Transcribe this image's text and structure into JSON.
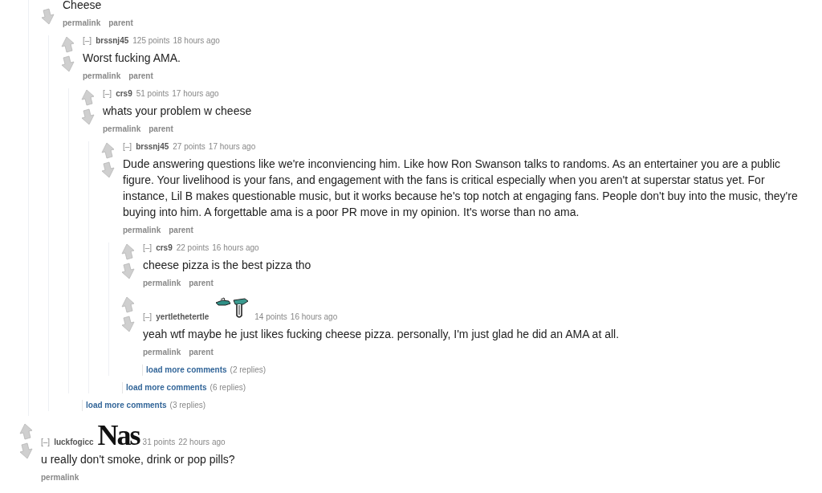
{
  "thread": {
    "comments": [
      {
        "body": "Cheese",
        "buttons": [
          "permalink",
          "parent"
        ],
        "children": [
          {
            "collapse": "[–]",
            "author": "brssnj45",
            "score": "125 points",
            "time": "18 hours ago",
            "body": "Worst fucking AMA.",
            "buttons": [
              "permalink",
              "parent"
            ],
            "children": [
              {
                "collapse": "[–]",
                "author": "crs9",
                "score": "51 points",
                "time": "17 hours ago",
                "body": "whats your problem w cheese",
                "buttons": [
                  "permalink",
                  "parent"
                ],
                "children": [
                  {
                    "collapse": "[–]",
                    "author": "brssnj45",
                    "score": "27 points",
                    "time": "17 hours ago",
                    "body": "Dude answering questions like we're inconviencing him. Like how Ron Swanson talks to randoms. As an entertainer you are a public figure. Your livelihood is your fans, and engagement with the fans is critical especially when you aren't at superstar status yet. For instance, Lil B makes questionable music, but it works because he's top notch at engaging fans. People don't buy into the music, they're buying into him. A forgettable ama is a poor PR move in my opinion. It's worse than no ama.",
                    "buttons": [
                      "permalink",
                      "parent"
                    ],
                    "children": [
                      {
                        "collapse": "[–]",
                        "author": "crs9",
                        "score": "22 points",
                        "time": "16 hours ago",
                        "body": "cheese pizza is the best pizza tho",
                        "buttons": [
                          "permalink",
                          "parent"
                        ]
                      },
                      {
                        "collapse": "[–]",
                        "author": "yertlethetertle",
                        "flair": {
                          "kind": "hands"
                        },
                        "score": "14 points",
                        "time": "16 hours ago",
                        "body": "yeah wtf maybe he just likes fucking cheese pizza. personally, I'm just glad he did an AMA at all.",
                        "buttons": [
                          "permalink",
                          "parent"
                        ]
                      }
                    ],
                    "more": {
                      "link": "load more comments",
                      "count": "(2 replies)"
                    }
                  }
                ],
                "more": {
                  "link": "load more comments",
                  "count": "(6 replies)"
                }
              }
            ]
          }
        ],
        "more": {
          "link": "load more comments",
          "count": "(3 replies)"
        }
      }
    ]
  },
  "comments": [
    {
      "collapse": "[–]",
      "author": "luckfogicc",
      "flair": {
        "kind": "text",
        "text": "Nas"
      },
      "score": "31 points",
      "time": "22 hours ago",
      "body": "u really don't smoke, drink or pop pills?",
      "buttons": [
        "permalink"
      ]
    }
  ]
}
